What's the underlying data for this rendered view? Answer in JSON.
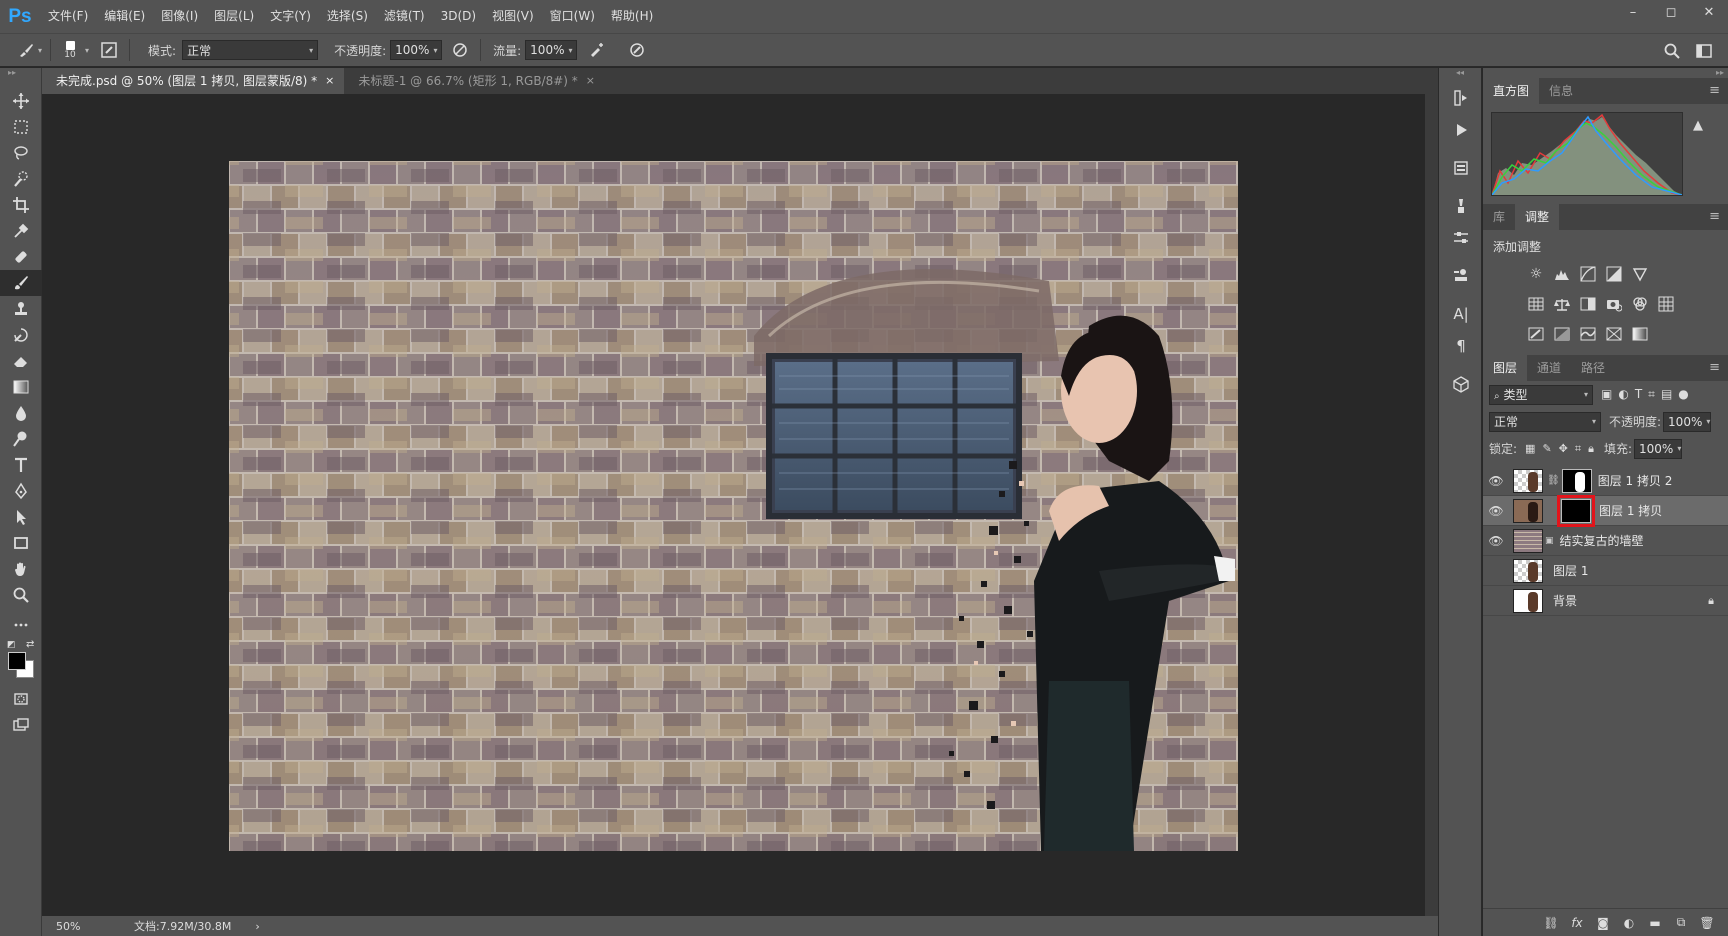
{
  "app": {
    "logo": "Ps"
  },
  "menu": [
    "文件(F)",
    "编辑(E)",
    "图像(I)",
    "图层(L)",
    "文字(Y)",
    "选择(S)",
    "滤镜(T)",
    "3D(D)",
    "视图(V)",
    "窗口(W)",
    "帮助(H)"
  ],
  "window_controls": {
    "minimize": "–",
    "restore": "◻",
    "close": "✕"
  },
  "options": {
    "brush_size": "10",
    "mode_label": "模式:",
    "mode_value": "正常",
    "opacity_label": "不透明度:",
    "opacity_value": "100%",
    "flow_label": "流量:",
    "flow_value": "100%"
  },
  "tabs": [
    {
      "label": "未完成.psd @ 50% (图层 1 拷贝, 图层蒙版/8) *",
      "close": "×"
    },
    {
      "label": "未标题-1 @ 66.7% (矩形 1, RGB/8#) *",
      "close": "×"
    }
  ],
  "status": {
    "zoom": "50%",
    "doc": "文档:7.92M/30.8M",
    "chevron": "›"
  },
  "panels": {
    "histogram_tabs": [
      "直方图",
      "信息"
    ],
    "adjust_tabs": [
      "库",
      "调整"
    ],
    "adjust_title": "添加调整",
    "layers_tabs": [
      "图层",
      "通道",
      "路径"
    ],
    "menu_glyph": "≡",
    "warn_glyph": "▲"
  },
  "layers_panel": {
    "filter_label": "类型",
    "blend_mode": "正常",
    "opacity_label": "不透明度:",
    "opacity_value": "100%",
    "lock_label": "锁定:",
    "fill_label": "填充:",
    "fill_value": "100%"
  },
  "layers": [
    {
      "name": "图层 1 拷贝 2",
      "visible": true,
      "has_mask": true,
      "selected": false
    },
    {
      "name": "图层 1 拷贝",
      "visible": true,
      "has_mask": true,
      "selected": true
    },
    {
      "name": "结实复古的墙壁",
      "visible": true,
      "has_mask": false,
      "selected": false
    },
    {
      "name": "图层 1",
      "visible": false,
      "has_mask": false,
      "selected": false
    },
    {
      "name": "背景",
      "visible": false,
      "has_mask": false,
      "selected": false,
      "locked": true
    }
  ],
  "colors": {
    "accent": "#31a8ff",
    "highlight": "#e3141b",
    "panel_bg": "#535353",
    "workspace": "#282828"
  }
}
